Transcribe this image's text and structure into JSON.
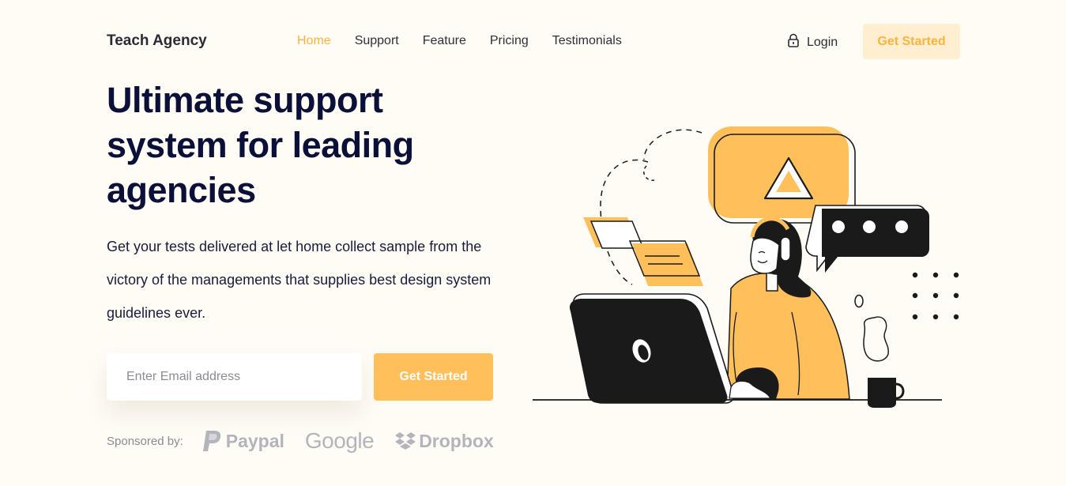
{
  "header": {
    "brand": "Teach Agency",
    "nav": [
      {
        "label": "Home",
        "active": true
      },
      {
        "label": "Support",
        "active": false
      },
      {
        "label": "Feature",
        "active": false
      },
      {
        "label": "Pricing",
        "active": false
      },
      {
        "label": "Testimonials",
        "active": false
      }
    ],
    "login_label": "Login",
    "login_icon": "lock-icon",
    "cta_label": "Get Started"
  },
  "hero": {
    "headline": "Ultimate support system for leading agencies",
    "subtext": "Get your tests delivered at let home collect sample from the victory of the managements that supplies best design system guidelines ever.",
    "email_placeholder": "Enter Email address",
    "cta_label": "Get Started"
  },
  "sponsors": {
    "label": "Sponsored by:",
    "logos": [
      "Paypal",
      "Google",
      "Dropbox"
    ]
  },
  "colors": {
    "accent": "#ffc05c",
    "accent_text": "#ffb33e",
    "accent_light": "#ffeecf",
    "background": "#fffcf6",
    "heading": "#0b1038"
  }
}
